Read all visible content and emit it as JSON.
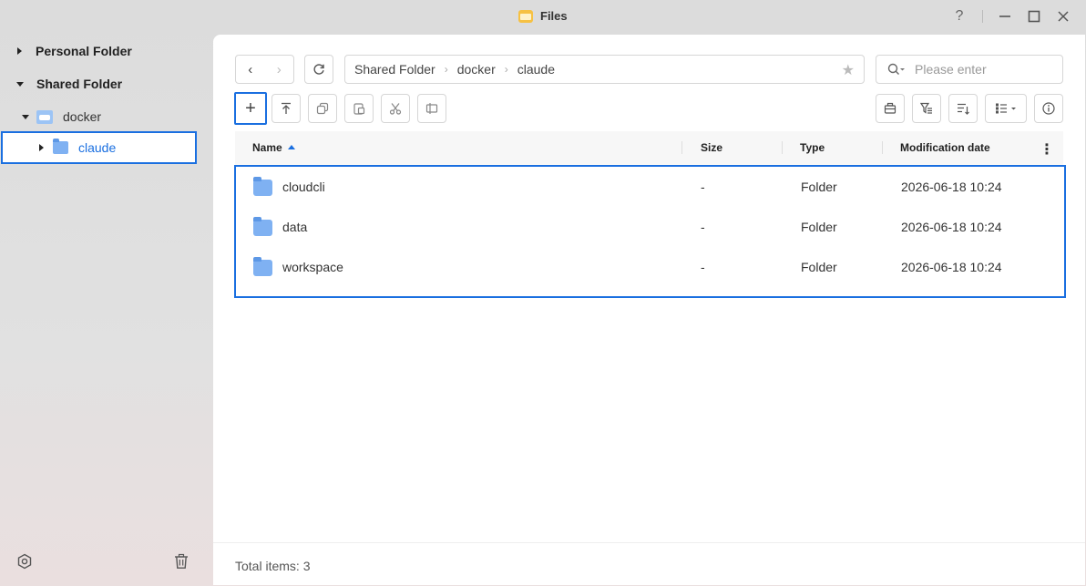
{
  "window": {
    "title": "Files",
    "controls": {
      "help": "?",
      "minimize": "—",
      "maximize": "☐",
      "close": "✕"
    }
  },
  "sidebar": {
    "personal_folder": "Personal Folder",
    "shared_folder": "Shared Folder",
    "docker": "docker",
    "claude": "claude"
  },
  "toolbar": {
    "back": "‹",
    "forward": "›",
    "refresh": "⟳",
    "breadcrumb": [
      "Shared Folder",
      "docker",
      "claude"
    ],
    "breadcrumb_sep": "›",
    "star": "★",
    "search_placeholder": "Please enter",
    "add": "+"
  },
  "table": {
    "headers": {
      "name": "Name",
      "size": "Size",
      "type": "Type",
      "modified": "Modification date"
    },
    "sort": {
      "column": "Name",
      "direction": "ascending"
    },
    "rows": [
      {
        "name": "cloudcli",
        "size": "-",
        "type": "Folder",
        "modified": "2026-06-18 10:24"
      },
      {
        "name": "data",
        "size": "-",
        "type": "Folder",
        "modified": "2026-06-18 10:24"
      },
      {
        "name": "workspace",
        "size": "-",
        "type": "Folder",
        "modified": "2026-06-18 10:24"
      }
    ]
  },
  "status": {
    "total": "Total items: 3"
  },
  "colors": {
    "accent": "#1a6fe0",
    "folder": "#7fb1f2",
    "app_icon": "#f6c143"
  }
}
